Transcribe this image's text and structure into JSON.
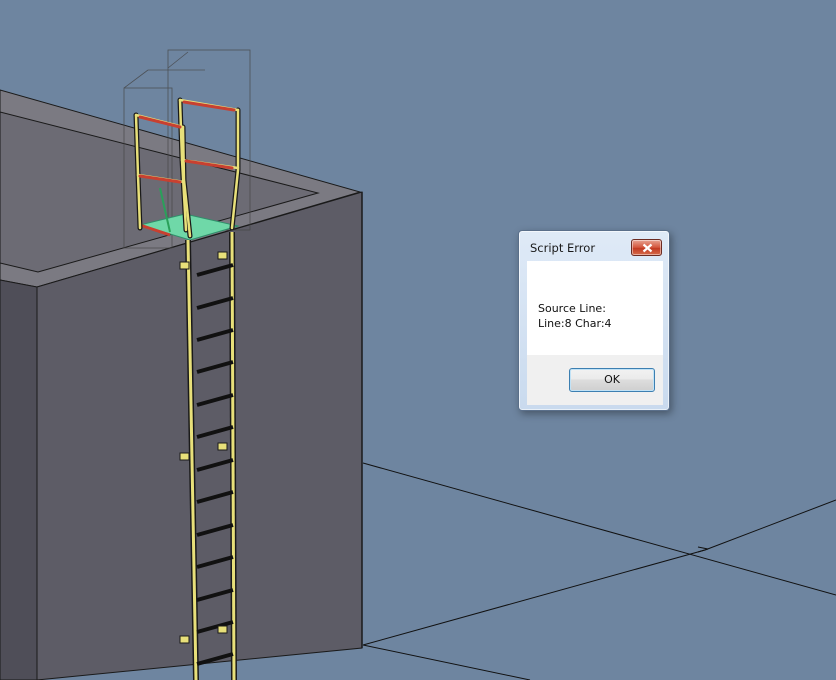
{
  "dialog": {
    "title": "Script Error",
    "message_line1": "Source Line:",
    "message_line2": "Line:8 Char:4",
    "ok_label": "OK"
  },
  "icons": {
    "close": "close-icon"
  },
  "colors": {
    "viewport_background": "#6e85a0",
    "wall_face": "#5d5c66",
    "wall_side": "#4f4e58",
    "wall_top": "#7b7a82",
    "ladder_yellow": "#e8e07a",
    "handrail_red": "#c84030",
    "platform_green": "#6fd8a8"
  }
}
